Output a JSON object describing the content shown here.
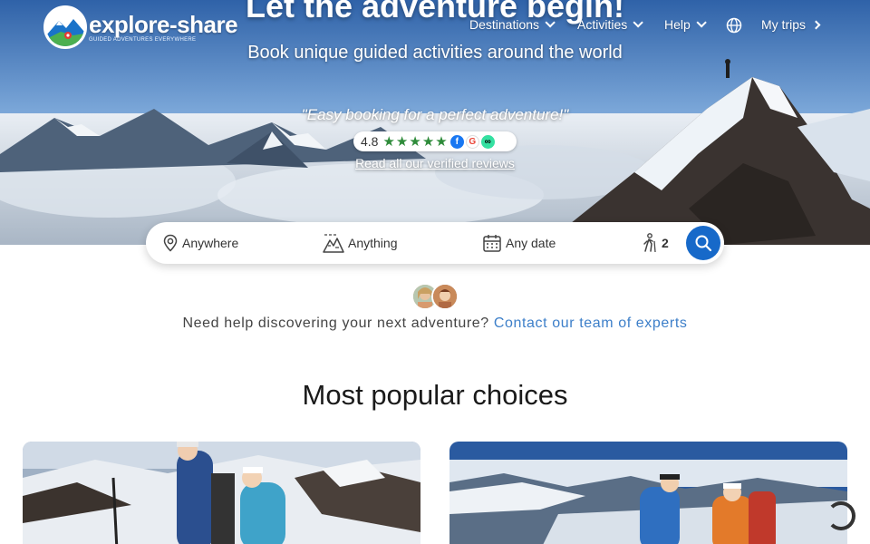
{
  "brand": {
    "name": "explore-share",
    "tagline": "GUIDED ADVENTURES EVERYWHERE"
  },
  "nav": {
    "items": [
      {
        "label": "Destinations",
        "icon": "chevron-down-icon"
      },
      {
        "label": "Activities",
        "icon": "chevron-down-icon"
      },
      {
        "label": "Help",
        "icon": "chevron-down-icon"
      },
      {
        "label": "",
        "icon": "globe-icon"
      },
      {
        "label": "My trips",
        "icon": "chevron-right-icon"
      }
    ]
  },
  "hero": {
    "title": "Let the adventure begin!",
    "subtitle": "Book unique guided activities around the world",
    "quote": "\"Easy booking for a perfect adventure!\"",
    "rating": "4.8",
    "stars": 5,
    "review_sources": [
      "facebook-icon",
      "google-icon",
      "tripadvisor-icon"
    ],
    "reviews_link": "Read all our verified reviews"
  },
  "search": {
    "where": "Anywhere",
    "what": "Anything",
    "when": "Any date",
    "guests": "2",
    "button_icon": "search-icon"
  },
  "help": {
    "text": "Need help discovering your next adventure?",
    "link": "Contact our team of experts"
  },
  "sections": {
    "popular_title": "Most popular choices"
  },
  "colors": {
    "accent": "#1769c9",
    "link": "#3d7fc9",
    "rating_green": "#2e8b3a"
  }
}
